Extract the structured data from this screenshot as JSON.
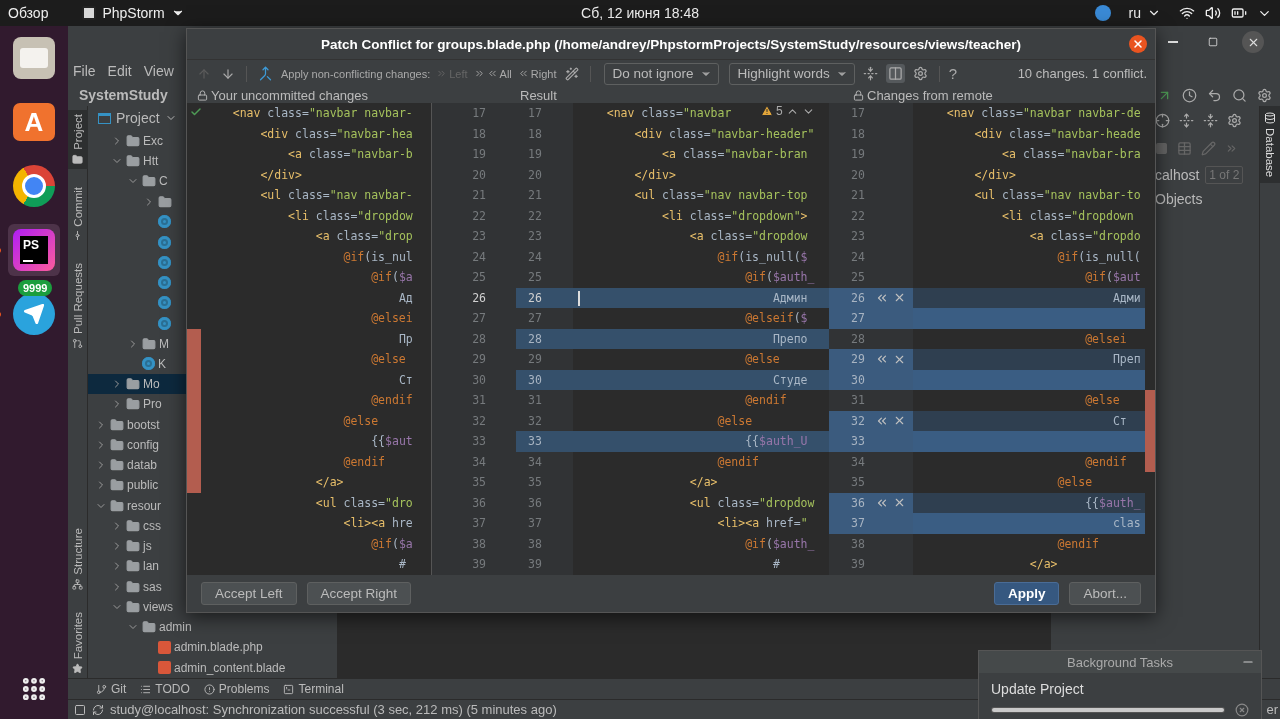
{
  "topbar": {
    "activities": "Обзор",
    "app": "PhpStorm",
    "clock": "Сб, 12 июня 18:48",
    "language": "ru"
  },
  "dock": [
    {
      "kind": "files",
      "selected": false,
      "running": false
    },
    {
      "kind": "store",
      "glyph": "A",
      "selected": false,
      "running": false
    },
    {
      "kind": "chrome",
      "selected": false,
      "running": false
    },
    {
      "kind": "phpstorm",
      "glyph": "PS",
      "selected": true,
      "running": true
    },
    {
      "kind": "telegram",
      "badge": "9999",
      "selected": false,
      "running": true
    }
  ],
  "ide": {
    "menu": [
      "File",
      "Edit",
      "View"
    ],
    "breadcrumb": "SystemStudy",
    "tool_strip_top": [
      {
        "label": "Project",
        "kind": "project",
        "selected": true
      },
      {
        "label": "Commit",
        "kind": "commit",
        "selected": false
      },
      {
        "label": "Pull Requests",
        "kind": "pull",
        "selected": false
      }
    ],
    "tool_strip_bottom": [
      {
        "label": "Structure",
        "kind": "structure",
        "selected": false
      },
      {
        "label": "Favorites",
        "kind": "favorites",
        "selected": false
      }
    ],
    "project": {
      "title": "Project",
      "tree": [
        {
          "children": [
            {
              "label": "Exc",
              "kind": "folder",
              "expanded": false,
              "selected": false
            },
            {
              "label": "Htt",
              "kind": "folder",
              "expanded": true,
              "selected": false,
              "children": [
                {
                  "label": "C",
                  "kind": "folder",
                  "expanded": true,
                  "selected": false,
                  "children": [
                    {
                      "kind": "folder",
                      "expanded": false,
                      "selected": false
                    },
                    {
                      "kind": "class",
                      "selected": false
                    },
                    {
                      "kind": "class",
                      "selected": false
                    },
                    {
                      "kind": "class",
                      "selected": false
                    },
                    {
                      "kind": "class",
                      "selected": false
                    },
                    {
                      "kind": "class",
                      "selected": false
                    },
                    {
                      "kind": "class",
                      "selected": false
                    }
                  ]
                },
                {
                  "label": "M",
                  "kind": "folder",
                  "expanded": false,
                  "selected": false
                },
                {
                  "label": "K",
                  "kind": "class",
                  "selected": false
                }
              ]
            },
            {
              "label": "Mo",
              "kind": "folder",
              "expanded": false,
              "selected": true
            },
            {
              "label": "Pro",
              "kind": "folder",
              "expanded": false,
              "selected": false
            }
          ]
        },
        {
          "label": "bootst",
          "kind": "folder",
          "expanded": false,
          "selected": false
        },
        {
          "label": "config",
          "kind": "folder",
          "expanded": false,
          "selected": false
        },
        {
          "label": "datab",
          "kind": "folder",
          "expanded": false,
          "selected": false
        },
        {
          "label": "public",
          "kind": "folder",
          "expanded": false,
          "selected": false
        },
        {
          "label": "resour",
          "kind": "folder",
          "expanded": true,
          "selected": false,
          "children": [
            {
              "label": "css",
              "kind": "folder",
              "expanded": false,
              "selected": false
            },
            {
              "label": "js",
              "kind": "folder",
              "expanded": false,
              "selected": false
            },
            {
              "label": "lan",
              "kind": "folder",
              "expanded": false,
              "selected": false
            },
            {
              "label": "sas",
              "kind": "folder",
              "expanded": false,
              "selected": false
            },
            {
              "label": "views",
              "kind": "folder",
              "expanded": true,
              "selected": false,
              "children": [
                {
                  "label": "admin",
                  "kind": "folder",
                  "expanded": true,
                  "selected": false,
                  "children": [
                    {
                      "label": "admin.blade.php",
                      "kind": "blade",
                      "selected": false
                    },
                    {
                      "label": "admin_content.blade",
                      "kind": "blade",
                      "selected": false
                    }
                  ]
                }
              ]
            }
          ]
        }
      ]
    },
    "database": {
      "tab": "Database",
      "connection": "calhost",
      "count": "1 of 2",
      "node": "Objects"
    },
    "tool_tabs": [
      {
        "label": "Git",
        "kind": "git"
      },
      {
        "label": "TODO",
        "kind": "todo"
      },
      {
        "label": "Problems",
        "kind": "problems"
      },
      {
        "label": "Terminal",
        "kind": "terminal"
      }
    ],
    "status_bar": {
      "message": "study@localhost: Synchronization successful (3 sec, 212 ms) (5 minutes ago)",
      "right": "er"
    },
    "background_tasks": {
      "title": "Background Tasks",
      "task": "Update Project",
      "level": 1
    }
  },
  "dialog": {
    "title": "Patch Conflict for groups.blade.php (/home/andrey/PhpstormProjects/SystemStudy/resources/views/teacher)",
    "toolbar": {
      "navigation": [
        {
          "kind": "previous",
          "disabled": true
        },
        {
          "kind": "next",
          "disabled": false
        }
      ],
      "apply_label": "Apply non-conflicting changes:",
      "apply_options": [
        {
          "label": "Left",
          "kind": "left",
          "disabled": true
        },
        {
          "label": "All",
          "kind": "all",
          "disabled": false
        },
        {
          "label": "Right",
          "kind": "right",
          "disabled": false
        }
      ],
      "whitespace": "Do not ignore",
      "highlight": "Highlight words",
      "layout_toggle": {
        "selected": true
      },
      "help": "?",
      "summary": "10 changes. 1 conflict."
    },
    "headers": {
      "left": "Your uncommitted changes",
      "result": "Result",
      "right": "Changes from remote"
    },
    "warnings": "5",
    "rows": [
      {
        "left_no": "17",
        "left": "    <nav class=\"navbar navbar-",
        "result_no": "17",
        "result": "    <nav class=\"navbar",
        "right_no": "17",
        "right": "    <nav class=\"navbar navbar-de",
        "result_changed": false,
        "kind": "plain",
        "actions": false,
        "current": false,
        "conflict_left": false,
        "conflict_right": false
      },
      {
        "left_no": "18",
        "left": "        <div class=\"navbar-hea",
        "result_no": "18",
        "result": "        <div class=\"navbar-header\"",
        "right_no": "18",
        "right": "        <div class=\"navbar-heade",
        "result_changed": false,
        "kind": "plain",
        "actions": false,
        "current": false,
        "conflict_left": false,
        "conflict_right": false
      },
      {
        "left_no": "19",
        "left": "            <a class=\"navbar-b",
        "result_no": "19",
        "result": "            <a class=\"navbar-bran",
        "right_no": "19",
        "right": "            <a class=\"navbar-bra",
        "result_changed": false,
        "kind": "plain",
        "actions": false,
        "current": false,
        "conflict_left": false,
        "conflict_right": false
      },
      {
        "left_no": "20",
        "left": "        </div>",
        "result_no": "20",
        "result": "        </div>",
        "right_no": "20",
        "right": "        </div>",
        "result_changed": false,
        "kind": "plain",
        "actions": false,
        "current": false,
        "conflict_left": false,
        "conflict_right": false
      },
      {
        "left_no": "21",
        "left": "        <ul class=\"nav navbar-",
        "result_no": "21",
        "result": "        <ul class=\"nav navbar-top",
        "right_no": "21",
        "right": "        <ul class=\"nav navbar-to",
        "result_changed": false,
        "kind": "plain",
        "actions": false,
        "current": false,
        "conflict_left": false,
        "conflict_right": false
      },
      {
        "left_no": "22",
        "left": "            <li class=\"dropdow",
        "result_no": "22",
        "result": "            <li class=\"dropdown\">",
        "right_no": "22",
        "right": "            <li class=\"dropdown",
        "result_changed": false,
        "kind": "plain",
        "actions": false,
        "current": false,
        "conflict_left": false,
        "conflict_right": false
      },
      {
        "left_no": "23",
        "left": "                <a class=\"drop",
        "result_no": "23",
        "result": "                <a class=\"dropdow",
        "right_no": "23",
        "right": "                <a class=\"dropdo",
        "result_changed": false,
        "kind": "plain",
        "actions": false,
        "current": false,
        "conflict_left": false,
        "conflict_right": false
      },
      {
        "left_no": "24",
        "left": "                    @if(is_nul",
        "result_no": "24",
        "result": "                    @if(is_null($",
        "right_no": "24",
        "right": "                    @if(is_null(",
        "result_changed": false,
        "kind": "plain",
        "actions": false,
        "current": false,
        "conflict_left": false,
        "conflict_right": false
      },
      {
        "left_no": "25",
        "left": "                        @if($a",
        "result_no": "25",
        "result": "                        @if($auth_",
        "right_no": "25",
        "right": "                        @if($aut",
        "result_changed": false,
        "kind": "plain",
        "actions": false,
        "current": false,
        "conflict_left": false,
        "conflict_right": false
      },
      {
        "left_no": "26",
        "left": "                            Ад",
        "result_no": "26",
        "result": "                            Админ",
        "right_no": "26",
        "right": "                            Адми",
        "result_changed": true,
        "kind": "modified",
        "actions": true,
        "current": true,
        "conflict_left": false,
        "conflict_right": false
      },
      {
        "left_no": "27",
        "left": "                        @elsei",
        "result_no": "27",
        "result": "                        @elseif($",
        "right_no": "27",
        "result_changed": false,
        "kind": "inserted",
        "actions": false,
        "current": false,
        "conflict_left": false,
        "conflict_right": false
      },
      {
        "left_no": "28",
        "left": "                            Пр",
        "result_no": "28",
        "result": "                            Препо",
        "right_no": "28",
        "right": "                        @elsei",
        "result_changed": true,
        "kind": "plain",
        "actions": false,
        "current": false,
        "conflict_left": true,
        "conflict_right": false
      },
      {
        "left_no": "29",
        "left": "                        @else",
        "result_no": "29",
        "result": "                        @else",
        "right_no": "29",
        "right": "                            Преп",
        "result_changed": false,
        "kind": "modified",
        "actions": true,
        "current": false,
        "conflict_left": true,
        "conflict_right": false
      },
      {
        "left_no": "30",
        "left": "                            Ст",
        "result_no": "30",
        "result": "                            Студе",
        "right_no": "30",
        "result_changed": true,
        "kind": "inserted",
        "actions": false,
        "current": false,
        "conflict_left": true,
        "conflict_right": false
      },
      {
        "left_no": "31",
        "left": "                        @endif",
        "result_no": "31",
        "result": "                        @endif",
        "right_no": "31",
        "right": "                        @else",
        "result_changed": false,
        "kind": "plain",
        "actions": false,
        "current": false,
        "conflict_left": true,
        "conflict_right": true
      },
      {
        "left_no": "32",
        "left": "                    @else",
        "result_no": "32",
        "result": "                    @else",
        "right_no": "32",
        "right": "                            Ст",
        "result_changed": false,
        "kind": "modified",
        "actions": true,
        "current": false,
        "conflict_left": true,
        "conflict_right": true
      },
      {
        "left_no": "33",
        "left": "                        {{$aut",
        "result_no": "33",
        "result": "                        {{$auth_U",
        "right_no": "33",
        "result_changed": true,
        "kind": "inserted",
        "actions": false,
        "current": false,
        "conflict_left": true,
        "conflict_right": true
      },
      {
        "left_no": "34",
        "left": "                    @endif",
        "result_no": "34",
        "result": "                    @endif",
        "right_no": "34",
        "right": "                        @endif",
        "result_changed": false,
        "kind": "plain",
        "actions": false,
        "current": false,
        "conflict_left": true,
        "conflict_right": true
      },
      {
        "left_no": "35",
        "left": "                </a>",
        "result_no": "35",
        "result": "                </a>",
        "right_no": "35",
        "right": "                    @else",
        "result_changed": false,
        "kind": "plain",
        "actions": false,
        "current": false,
        "conflict_left": true,
        "conflict_right": false
      },
      {
        "left_no": "36",
        "left": "                <ul class=\"dro",
        "result_no": "36",
        "result": "                <ul class=\"dropdow",
        "right_no": "36",
        "right": "                        {{$auth_",
        "result_changed": false,
        "kind": "modified",
        "actions": true,
        "current": false,
        "conflict_left": false,
        "conflict_right": false
      },
      {
        "left_no": "37",
        "left": "                    <li><a hre",
        "result_no": "37",
        "result": "                    <li><a href=\"",
        "right_no": "37",
        "right": "                            clas",
        "result_changed": false,
        "kind": "inserted",
        "actions": false,
        "current": false,
        "conflict_left": false,
        "conflict_right": false
      },
      {
        "left_no": "38",
        "left": "                        @if($a",
        "result_no": "38",
        "result": "                        @if($auth_",
        "right_no": "38",
        "right": "                    @endif",
        "result_changed": false,
        "kind": "plain",
        "actions": false,
        "current": false,
        "conflict_left": false,
        "conflict_right": false
      },
      {
        "left_no": "39",
        "left": "                            #",
        "result_no": "39",
        "result": "                            #",
        "right_no": "39",
        "right": "                </a>",
        "result_changed": false,
        "kind": "plain",
        "actions": false,
        "current": false,
        "conflict_left": false,
        "conflict_right": false
      }
    ],
    "buttons": [
      {
        "label": "Accept Left",
        "kind": "left",
        "primary": false
      },
      {
        "label": "Accept Right",
        "kind": "left",
        "primary": false
      },
      {
        "label": "Apply",
        "kind": "right",
        "primary": true
      },
      {
        "label": "Abort...",
        "kind": "right",
        "primary": false
      }
    ]
  }
}
